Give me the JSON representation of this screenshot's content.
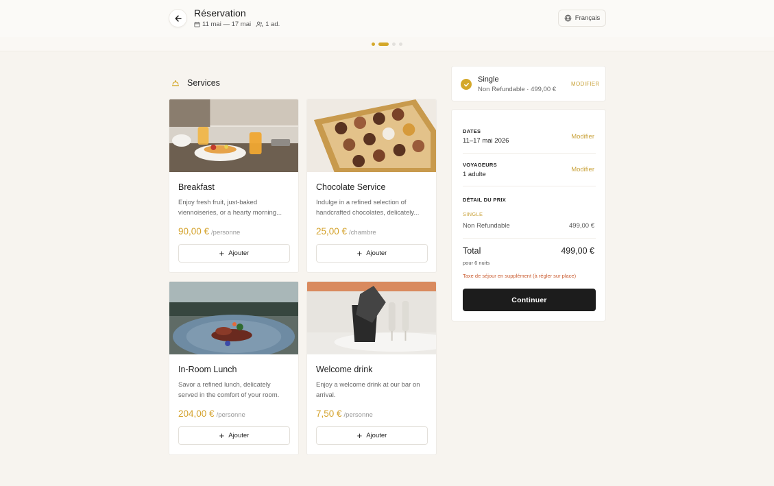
{
  "header": {
    "title": "Réservation",
    "dates": "11 mai — 17 mai",
    "guests": "1 ad.",
    "language": "Français"
  },
  "stepper": {
    "steps": 4,
    "current": 2
  },
  "services": {
    "heading": "Services",
    "add_label": "Ajouter",
    "items": [
      {
        "title": "Breakfast",
        "desc": "Enjoy fresh fruit, just-baked viennoiseries, or a hearty morning...",
        "price": "90,00 €",
        "unit": "/personne"
      },
      {
        "title": "Chocolate Service",
        "desc": "Indulge in a refined selection of handcrafted chocolates, delicately...",
        "price": "25,00 €",
        "unit": "/chambre"
      },
      {
        "title": "In-Room Lunch",
        "desc": "Savor a refined lunch, delicately served in the comfort of your room.",
        "price": "204,00 €",
        "unit": "/personne"
      },
      {
        "title": "Welcome drink",
        "desc": "Enjoy a welcome drink at our bar on arrival.",
        "price": "7,50 €",
        "unit": "/personne"
      }
    ]
  },
  "room": {
    "name": "Single",
    "sub": "Non Refundable · 499,00 €",
    "modify": "MODIFIER"
  },
  "summary": {
    "dates_label": "DATES",
    "dates_value": "11–17 mai 2026",
    "travelers_label": "VOYAGEURS",
    "travelers_value": "1 adulte",
    "modify": "Modifier",
    "price_detail_label": "DÉTAIL DU PRIX",
    "room_tag": "SINGLE",
    "rate_label": "Non Refundable",
    "rate_value": "499,00 €",
    "total_label": "Total",
    "total_value": "499,00 €",
    "nights": "pour 6 nuits",
    "tax_note": "Taxe de séjour en supplément (à régler sur place)",
    "continue": "Continuer"
  },
  "colors": {
    "accent": "#d4a82a",
    "primary_button": "#1c1c1c",
    "tax_note": "#c95a2e"
  }
}
